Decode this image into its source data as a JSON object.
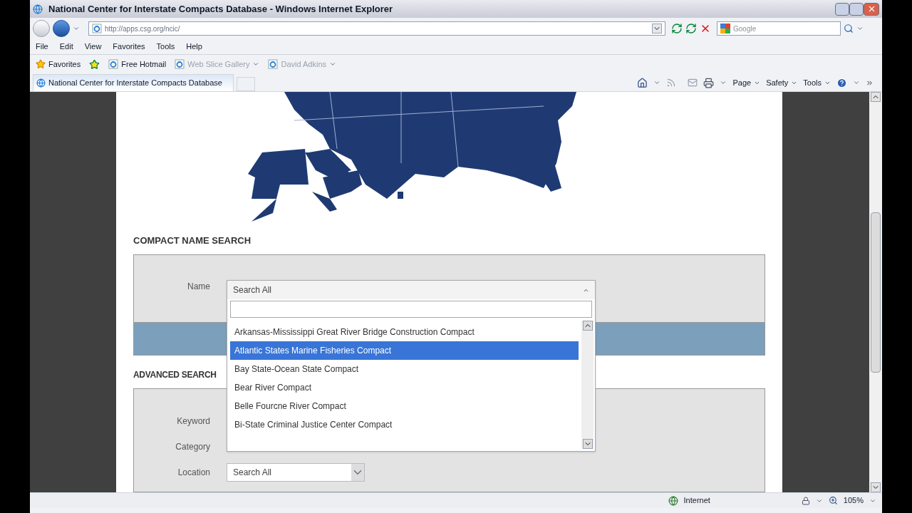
{
  "window": {
    "title": "National Center for Interstate Compacts Database - Windows Internet Explorer"
  },
  "address_bar": {
    "url": "http://apps.csg.org/ncic/"
  },
  "search_box": {
    "placeholder": "Google"
  },
  "menu": [
    "File",
    "Edit",
    "View",
    "Favorites",
    "Tools",
    "Help"
  ],
  "favorites_bar": {
    "label": "Favorites",
    "links": [
      {
        "label": "Free Hotmail",
        "dropdown": false,
        "dimmed": false
      },
      {
        "label": "Web Slice Gallery",
        "dropdown": true,
        "dimmed": true
      },
      {
        "label": "David Adkins",
        "dropdown": true,
        "dimmed": true
      }
    ]
  },
  "tabs": [
    {
      "label": "National Center for Interstate Compacts Database",
      "selected": true
    }
  ],
  "command_bar": [
    "Page",
    "Safety",
    "Tools"
  ],
  "page": {
    "compact_name_search": {
      "heading": "COMPACT NAME SEARCH",
      "field_label": "Name",
      "dropdown": {
        "value": "Search All",
        "expanded": true,
        "options": [
          {
            "label": "Arkansas-Mississippi Great River Bridge Construction Compact",
            "selected": false
          },
          {
            "label": "Atlantic States Marine Fisheries Compact",
            "selected": true
          },
          {
            "label": "Bay State-Ocean State Compact",
            "selected": false
          },
          {
            "label": "Bear River Compact",
            "selected": false
          },
          {
            "label": "Belle Fourcne River Compact",
            "selected": false
          },
          {
            "label": "Bi-State Criminal Justice Center Compact",
            "selected": false
          }
        ]
      }
    },
    "advanced_search": {
      "heading": "ADVANCED SEARCH",
      "fields": [
        {
          "label": "Keyword"
        },
        {
          "label": "Category"
        },
        {
          "label": "Location",
          "value": "Search All"
        }
      ]
    }
  },
  "status_bar": {
    "zone": "Internet",
    "zoom": "105%"
  }
}
